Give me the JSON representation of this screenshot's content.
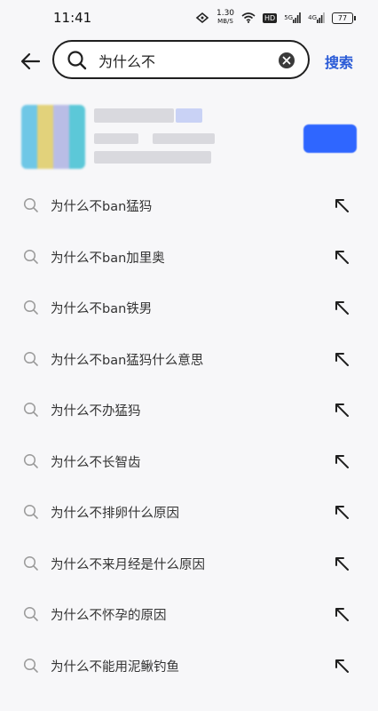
{
  "status_bar": {
    "time": "11:41",
    "speed_value": "1.30",
    "speed_unit": "MB/S",
    "hd_label": "HD",
    "signal1_label": "5G",
    "signal2_label": "4G",
    "battery": "77"
  },
  "search": {
    "query": "为什么不",
    "button_label": "搜索"
  },
  "suggestions": [
    "为什么不ban猛犸",
    "为什么不ban加里奥",
    "为什么不ban铁男",
    "为什么不ban猛犸什么意思",
    "为什么不办猛犸",
    "为什么不长智齿",
    "为什么不排卵什么原因",
    "为什么不来月经是什么原因",
    "为什么不怀孕的原因",
    "为什么不能用泥鳅钓鱼"
  ],
  "colors": {
    "accent": "#2a5bd7",
    "background": "#f7f7f9"
  }
}
